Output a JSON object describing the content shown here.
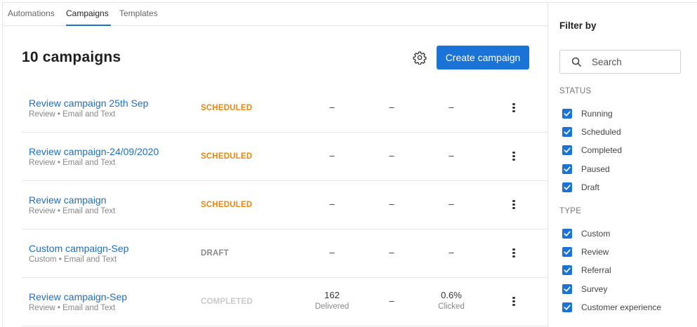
{
  "tabs": [
    {
      "label": "Automations"
    },
    {
      "label": "Campaigns"
    },
    {
      "label": "Templates"
    }
  ],
  "active_tab": "Campaigns",
  "header": {
    "title": "10 campaigns",
    "create_label": "Create campaign",
    "settings_icon": "gear-icon"
  },
  "campaigns": [
    {
      "name": "Review campaign 25th Sep",
      "sub": "Review • Email and Text",
      "status": "SCHEDULED",
      "m1": {
        "value": "–",
        "label": ""
      },
      "m2": {
        "value": "–",
        "label": ""
      },
      "m3": {
        "value": "–",
        "label": ""
      }
    },
    {
      "name": "Review campaign-24/09/2020",
      "sub": "Review • Email and Text",
      "status": "SCHEDULED",
      "m1": {
        "value": "–",
        "label": ""
      },
      "m2": {
        "value": "–",
        "label": ""
      },
      "m3": {
        "value": "–",
        "label": ""
      }
    },
    {
      "name": "Review campaign",
      "sub": "Review • Email and Text",
      "status": "SCHEDULED",
      "m1": {
        "value": "–",
        "label": ""
      },
      "m2": {
        "value": "–",
        "label": ""
      },
      "m3": {
        "value": "–",
        "label": ""
      }
    },
    {
      "name": "Custom campaign-Sep",
      "sub": "Custom • Email and Text",
      "status": "DRAFT",
      "m1": {
        "value": "–",
        "label": ""
      },
      "m2": {
        "value": "–",
        "label": ""
      },
      "m3": {
        "value": "–",
        "label": ""
      }
    },
    {
      "name": "Review campaign-Sep",
      "sub": "Review • Email and Text",
      "status": "COMPLETED",
      "m1": {
        "value": "162",
        "label": "Delivered"
      },
      "m2": {
        "value": "–",
        "label": ""
      },
      "m3": {
        "value": "0.6%",
        "label": "Clicked"
      }
    }
  ],
  "status_colors": {
    "SCHEDULED": "#e8870e",
    "DRAFT": "#8a8a8a",
    "COMPLETED": "#c9c9c9"
  },
  "accent_color": "#1a73d6",
  "filter": {
    "title": "Filter by",
    "search_placeholder": "Search",
    "status_heading": "STATUS",
    "status_options": [
      {
        "label": "Running",
        "checked": true
      },
      {
        "label": "Scheduled",
        "checked": true
      },
      {
        "label": "Completed",
        "checked": true
      },
      {
        "label": "Paused",
        "checked": true
      },
      {
        "label": "Draft",
        "checked": true
      }
    ],
    "type_heading": "TYPE",
    "type_options": [
      {
        "label": "Custom",
        "checked": true
      },
      {
        "label": "Review",
        "checked": true
      },
      {
        "label": "Referral",
        "checked": true
      },
      {
        "label": "Survey",
        "checked": true
      },
      {
        "label": "Customer experience",
        "checked": true
      }
    ]
  }
}
